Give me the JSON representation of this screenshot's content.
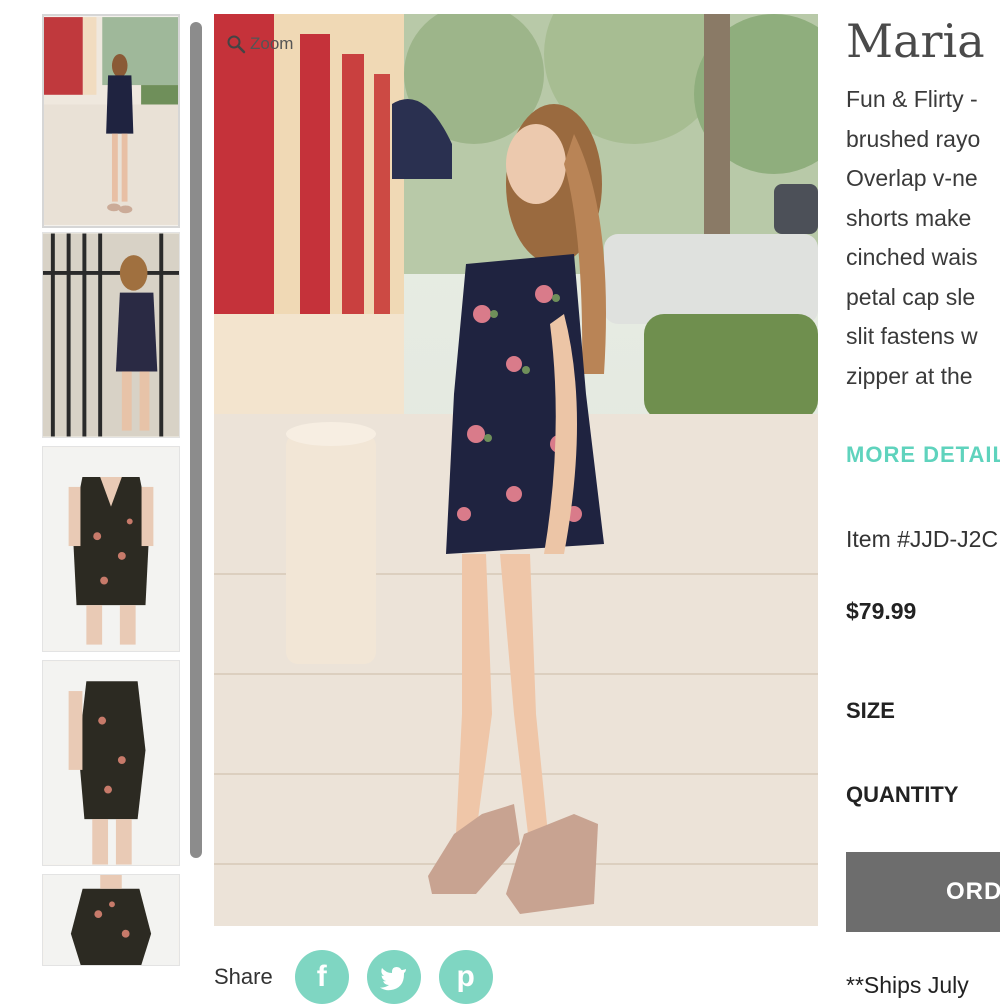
{
  "gallery": {
    "thumbnails": [
      {
        "alt": "",
        "active": true
      },
      {
        "alt": "",
        "active": false
      },
      {
        "alt": "",
        "active": false
      },
      {
        "alt": "",
        "active": false
      },
      {
        "alt": "",
        "active": false
      }
    ],
    "zoom_label": "Zoom",
    "zoom_icon": "magnifier-icon"
  },
  "share": {
    "label": "Share",
    "buttons": [
      {
        "icon": "facebook-icon",
        "glyph": "f"
      },
      {
        "icon": "twitter-icon",
        "glyph": ""
      },
      {
        "icon": "pinterest-icon",
        "glyph": "p"
      }
    ],
    "button_color": "#7fd6c2"
  },
  "product": {
    "title": "Maria",
    "description_lines": [
      "Fun & Flirty -",
      "brushed rayo",
      "Overlap v-ne",
      "shorts make",
      "cinched wais",
      "petal cap sle",
      "slit fastens w",
      "zipper at the"
    ],
    "more_details": "MORE DETAIL",
    "item_number": "Item #JJD-J2C",
    "price": "$79.99",
    "size_label": "SIZE",
    "quantity_label": "QUANTITY",
    "order_button": "ORD",
    "shipping_note": "**Ships July",
    "accent_color": "#5fd3bd"
  }
}
